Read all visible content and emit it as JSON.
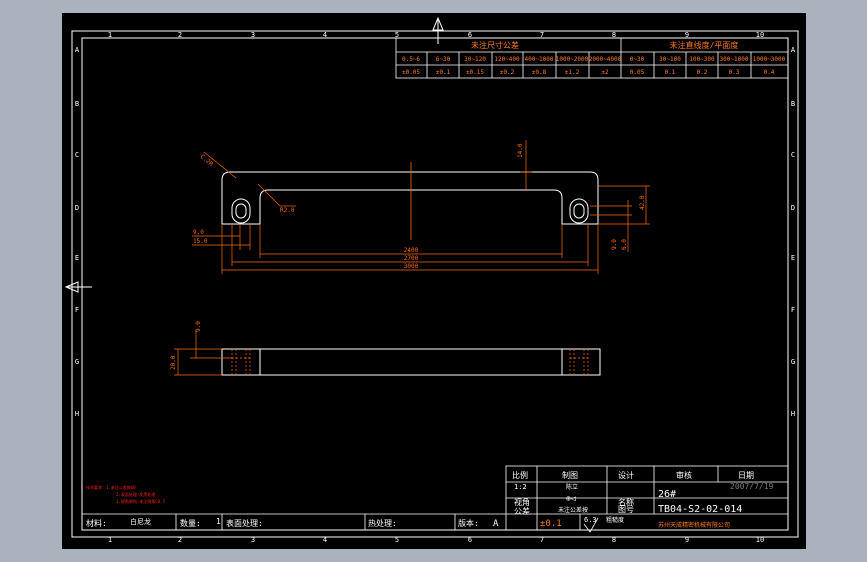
{
  "colors": {
    "bg": "#000000",
    "frame": "#ffffff",
    "dim": "#ff6a00",
    "title": "#ff7a1a",
    "note": "#ff2020",
    "grey": "#777777"
  },
  "grid": {
    "cols": [
      "1",
      "2",
      "3",
      "4",
      "5",
      "6",
      "7",
      "8",
      "9",
      "10"
    ],
    "rows": [
      "A",
      "B",
      "C",
      "D",
      "E",
      "F",
      "G",
      "H"
    ]
  },
  "tolerance_table": {
    "heading_left": "未注尺寸公差",
    "heading_right": "未注直线度/平面度",
    "ranges_left": [
      "0.5~6",
      "6~30",
      "30~120",
      "120~400",
      "400~1000",
      "1000~2000",
      "2000~4000"
    ],
    "values_left": [
      "±0.05",
      "±0.1",
      "±0.15",
      "±0.2",
      "±0.8",
      "±1.2",
      "±2"
    ],
    "ranges_right": [
      "0~30",
      "30~100",
      "100~300",
      "300~1000",
      "1000~3000"
    ],
    "values_right": [
      "0.05",
      "0.1",
      "0.2",
      "0.3",
      "0.4"
    ]
  },
  "dimensions": {
    "chamfer": "C.2R",
    "top_gap": "14.0",
    "slot": "R2.0",
    "side_height": "42.0",
    "left_a": "9.0",
    "left_b": "15.0",
    "inner_len": "2400",
    "mid_len": "2700",
    "total_len": "3000",
    "right_a": "9.0",
    "right_b": "6.0",
    "side_top": "9.0",
    "side_total": "20.0"
  },
  "notes": [
    "技术要求：1.未注公差按GB",
    "2.表面处理:发黑处理",
    "3.锐角倒钝:未注倒角C0.5"
  ],
  "title_block": {
    "scale_label": "比例",
    "scale_value": "1:2",
    "drawn_label": "制图",
    "drawn_value": "陈立",
    "design_label": "设计",
    "check_label": "审核",
    "date_label": "日期",
    "date_value": "2007/7/19",
    "view_label": "视角",
    "view_symbol": "⊕◁",
    "name_label": "名称",
    "name_value": "26#",
    "qty_label": "数量",
    "qty_value": "1",
    "tol_label": "公差",
    "tol_value": "±0.1",
    "material_note": "未注公差按",
    "drawing_no_label": "图号",
    "drawing_no_value": "TB04-S2-02-014",
    "surface_label": "粗糙度",
    "roughness": "6.3",
    "company": "苏州天成精密机械有限公司",
    "material_label": "材料:",
    "material_value": "白尼龙",
    "count_label": "数量:",
    "count_value": "1",
    "finish_label": "表面处理:",
    "heat_label": "热处理:",
    "rev_label": "版本:",
    "rev_value": "A"
  }
}
